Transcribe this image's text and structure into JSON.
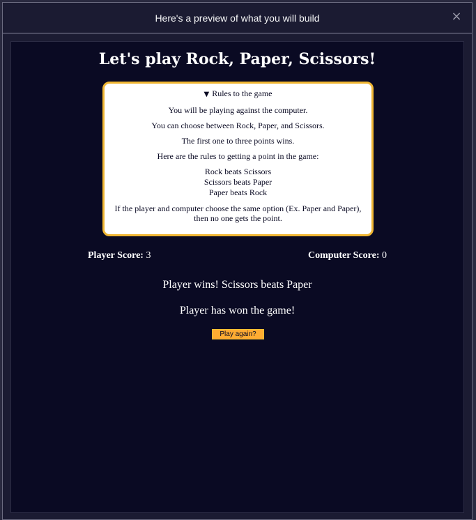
{
  "modal": {
    "title": "Here's a preview of what you will build",
    "close_icon": "×"
  },
  "game": {
    "title": "Let's play Rock, Paper, Scissors!",
    "rules": {
      "summary": "Rules to the game",
      "summary_icon": "▼",
      "lines": [
        "You will be playing against the computer.",
        "You can choose between Rock, Paper, and Scissors.",
        "The first one to three points wins.",
        "Here are the rules to getting a point in the game:"
      ],
      "matchups": [
        "Rock beats Scissors",
        "Scissors beats Paper",
        "Paper beats Rock"
      ],
      "tie_rule": "If the player and computer choose the same option (Ex. Paper and Paper), then no one gets the point."
    },
    "scores": {
      "player_label": "Player Score:",
      "player_value": "3",
      "computer_label": "Computer Score:",
      "computer_value": "0"
    },
    "result_message": "Player wins! Scissors beats Paper",
    "winner_message": "Player has won the game!",
    "play_again_label": "Play again?"
  },
  "colors": {
    "background": "#0a0a23",
    "accent": "#feac32",
    "border": "#f0b632"
  }
}
